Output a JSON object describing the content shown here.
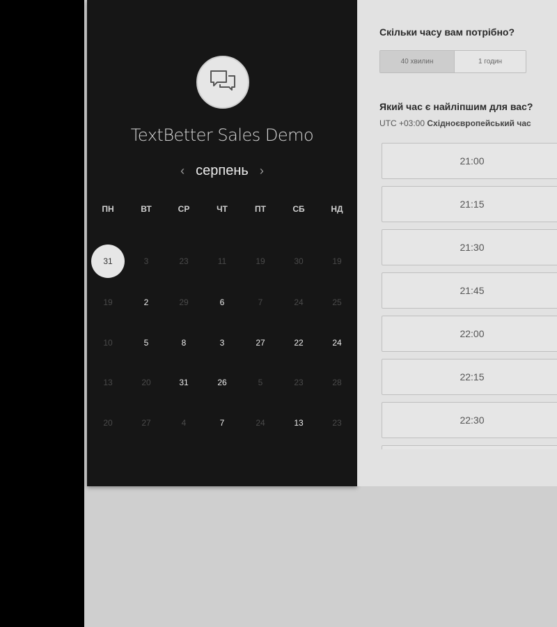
{
  "event": {
    "title": "TextBetter Sales Demo",
    "icon": "chat-bubbles-icon"
  },
  "calendar": {
    "month": "серпень",
    "prev": "‹",
    "next": "›",
    "weekdays": [
      "ПН",
      "ВТ",
      "СР",
      "ЧТ",
      "ПТ",
      "СБ",
      "НД"
    ],
    "weeks": [
      [
        {
          "d": "31",
          "s": "selected"
        },
        {
          "d": "3",
          "s": "muted"
        },
        {
          "d": "23",
          "s": "muted"
        },
        {
          "d": "11",
          "s": "muted"
        },
        {
          "d": "19",
          "s": "muted"
        },
        {
          "d": "30",
          "s": "muted"
        },
        {
          "d": "19",
          "s": "muted"
        }
      ],
      [
        {
          "d": "19",
          "s": "muted"
        },
        {
          "d": "2",
          "s": "active"
        },
        {
          "d": "29",
          "s": "muted"
        },
        {
          "d": "6",
          "s": "active"
        },
        {
          "d": "7",
          "s": "muted"
        },
        {
          "d": "24",
          "s": "muted"
        },
        {
          "d": "25",
          "s": "muted"
        }
      ],
      [
        {
          "d": "10",
          "s": "muted"
        },
        {
          "d": "5",
          "s": "active"
        },
        {
          "d": "8",
          "s": "active"
        },
        {
          "d": "3",
          "s": "active"
        },
        {
          "d": "27",
          "s": "active"
        },
        {
          "d": "22",
          "s": "active"
        },
        {
          "d": "24",
          "s": "active"
        }
      ],
      [
        {
          "d": "13",
          "s": "muted"
        },
        {
          "d": "20",
          "s": "muted"
        },
        {
          "d": "31",
          "s": "active"
        },
        {
          "d": "26",
          "s": "active"
        },
        {
          "d": "5",
          "s": "muted"
        },
        {
          "d": "23",
          "s": "muted"
        },
        {
          "d": "28",
          "s": "muted"
        }
      ],
      [
        {
          "d": "20",
          "s": "muted"
        },
        {
          "d": "27",
          "s": "muted"
        },
        {
          "d": "4",
          "s": "muted"
        },
        {
          "d": "7",
          "s": "active"
        },
        {
          "d": "24",
          "s": "muted"
        },
        {
          "d": "13",
          "s": "active"
        },
        {
          "d": "23",
          "s": "muted"
        }
      ]
    ]
  },
  "booking": {
    "duration_question": "Скільки часу вам потрібно?",
    "durations": [
      "40 хвилин",
      "1 годин"
    ],
    "selected_duration": "40 хвилин",
    "time_question": "Який час є найліпшим для вас?",
    "timezone_offset": "UTC +03:00",
    "timezone_name": "Східноєвропейський час",
    "slots": [
      "21:00",
      "21:15",
      "21:30",
      "21:45",
      "22:00",
      "22:15",
      "22:30"
    ]
  },
  "colors": {
    "left_panel": "#161616",
    "right_panel": "#e2e2e2",
    "page_background": "#cfcfcf",
    "outer_background": "#000000"
  }
}
